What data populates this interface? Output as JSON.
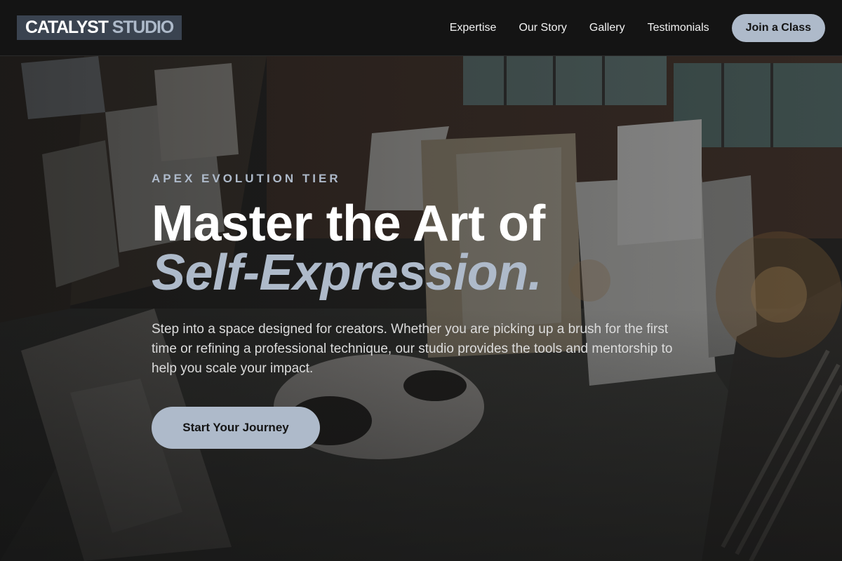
{
  "brand": {
    "main": "CATALYST",
    "sub": "STUDIO"
  },
  "nav": {
    "links": [
      {
        "label": "Expertise"
      },
      {
        "label": "Our Story"
      },
      {
        "label": "Gallery"
      },
      {
        "label": "Testimonials"
      }
    ],
    "cta_label": "Join a Class"
  },
  "hero": {
    "eyebrow": "APEX EVOLUTION TIER",
    "headline_line1": "Master the Art of",
    "headline_line2": "Self-Expression.",
    "description": "Step into a space designed for creators. Whether you are picking up a brush for the first time or refining a professional technique, our studio provides the tools and mentorship to help you scale your impact.",
    "cta_label": "Start Your Journey",
    "background_image": "art-studio-photo"
  },
  "colors": {
    "page_background": "#141414",
    "accent": "#aebaca",
    "logo_background": "#3a4350",
    "text_primary": "#ffffff",
    "text_secondary": "#dcdcdc"
  }
}
